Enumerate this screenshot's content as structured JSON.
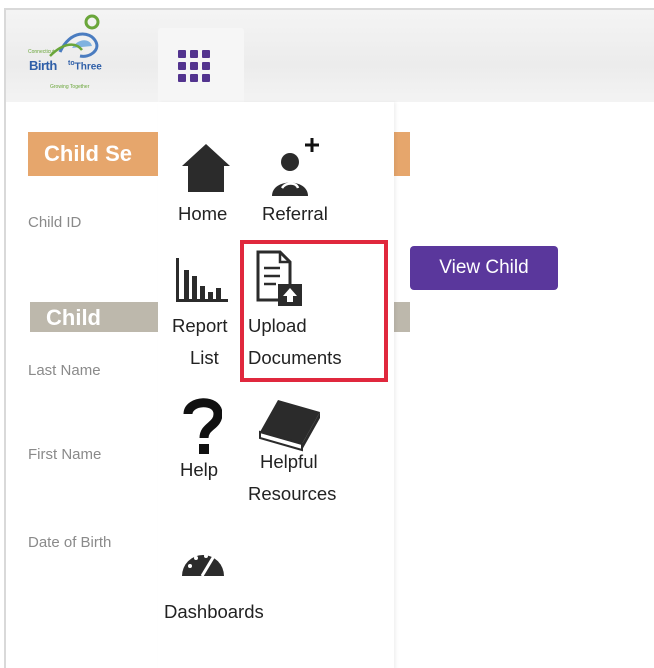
{
  "logo": {
    "line_pre": "Connecticut",
    "word_birth": "Birth",
    "word_to": "to",
    "word_three": "Three",
    "tagline": "Growing Together"
  },
  "header": {
    "apps_button": "apps-grid"
  },
  "child_search": {
    "title": "Child Se",
    "child_id_label": "Child ID",
    "view_child_label": "View Child"
  },
  "child": {
    "title": "Child",
    "last_name_label": "Last Name",
    "first_name_label": "First Name",
    "dob_label": "Date of Birth"
  },
  "menu": {
    "home": "Home",
    "referral": "Referral",
    "report_list_1": "Report",
    "report_list_2": "List",
    "upload_1": "Upload",
    "upload_2": "Documents",
    "help": "Help",
    "helpful_1": "Helpful",
    "helpful_2": "Resources",
    "dashboards": "Dashboards"
  },
  "icons": [
    "home-icon",
    "add-referral-icon",
    "bar-chart-icon",
    "upload-document-icon",
    "question-icon",
    "book-icon",
    "dashboard-gauge-icon"
  ],
  "colors": {
    "accent_purple": "#5a379c",
    "section_orange": "#e6a66c",
    "section_gray": "#bdb8ac",
    "highlight_red": "#e0283d"
  }
}
